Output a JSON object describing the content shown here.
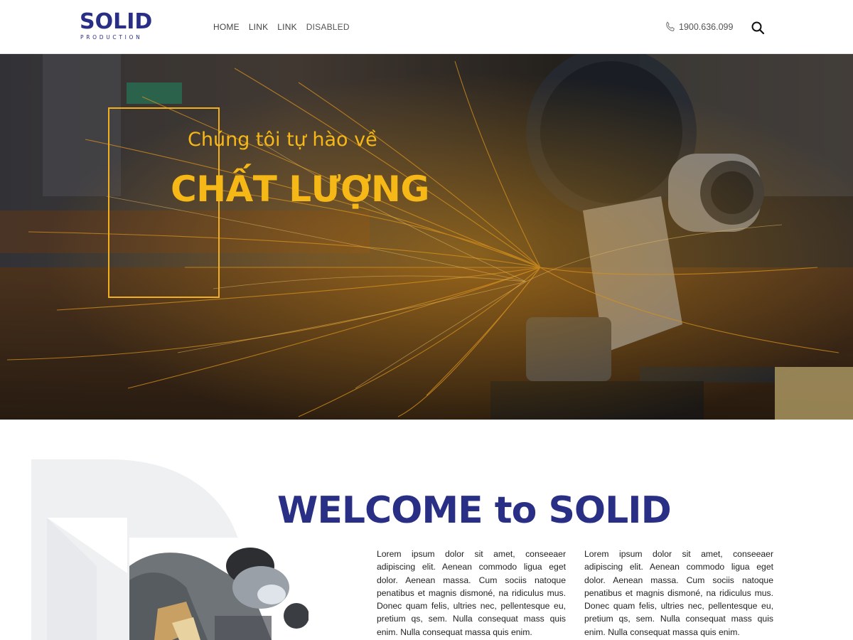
{
  "header": {
    "logo": {
      "main": "SOLID",
      "sub": "PRODUCTION"
    },
    "nav": [
      {
        "label": "HOME"
      },
      {
        "label": "LINK"
      },
      {
        "label": "LINK"
      },
      {
        "label": "DISABLED"
      }
    ],
    "phone": {
      "icon": "phone-icon",
      "text": "1900.636.099"
    },
    "search": {
      "icon": "search-icon"
    }
  },
  "hero": {
    "line1": "Chúng tôi tự hào về",
    "line2": "CHẤT LƯỢNG",
    "accent_color": "#f6b817"
  },
  "welcome": {
    "title": "WELCOME to SOLID",
    "title_color": "#2a2f86",
    "columns": [
      "Lorem ipsum dolor sit amet, conseeaer adipiscing elit. Aenean commodo ligua eget dolor. Aenean massa. Cum sociis natoque penatibus et magnis dismoné, na ridiculus mus. Donec quam felis, ultries nec, pellentesque eu, pretium qs, sem. Nulla consequat mass quis enim. Nulla consequat massa quis enim.",
      "Lorem ipsum dolor sit amet, conseeaer adipiscing elit. Aenean commodo ligua eget dolor. Aenean massa. Cum sociis natoque penatibus et magnis dismoné, na ridiculus mus. Donec quam felis, ultries nec, pellentesque eu, pretium qs, sem. Nulla consequat mass quis enim. Nulla consequat massa quis enim."
    ]
  }
}
